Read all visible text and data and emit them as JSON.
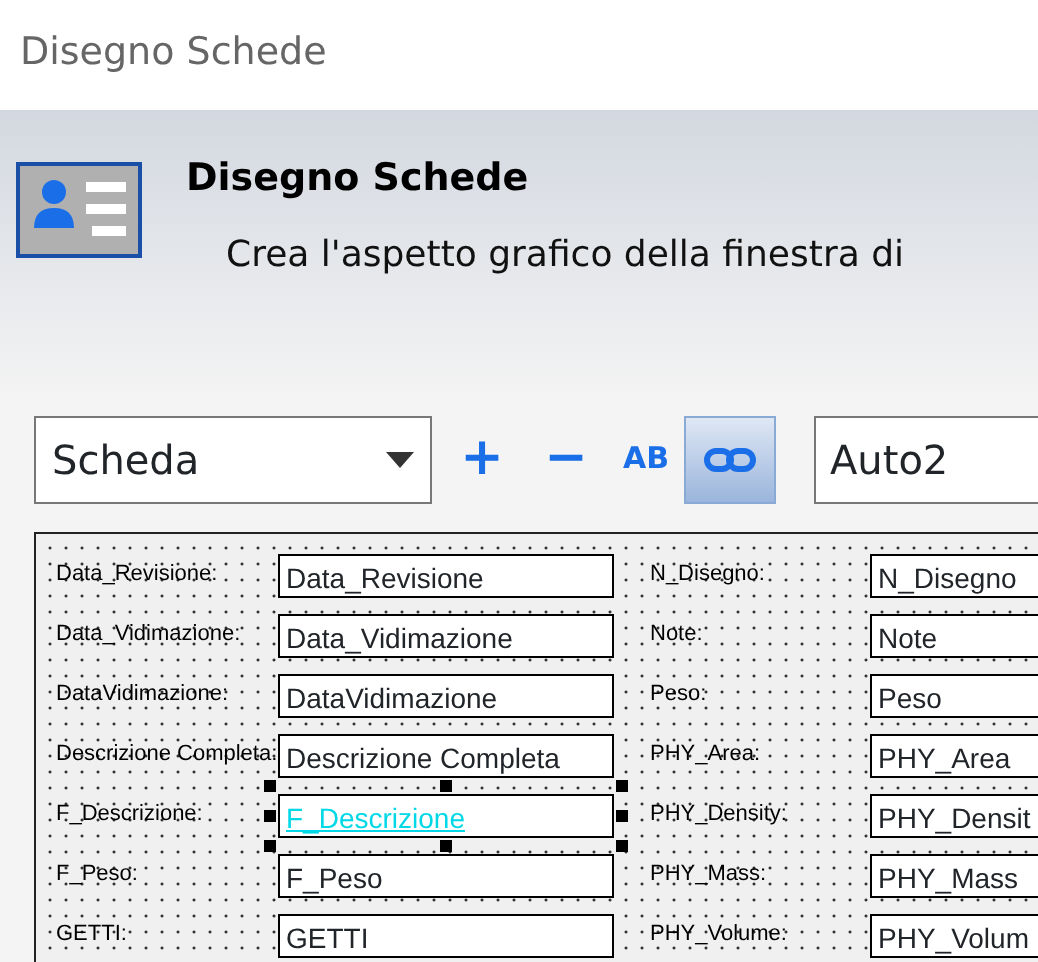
{
  "window": {
    "title": "Disegno Schede"
  },
  "header": {
    "title": "Disegno Schede",
    "subtitle": "Crea l'aspetto grafico della finestra di"
  },
  "toolbar": {
    "selector": {
      "value": "Scheda"
    },
    "tools": [
      {
        "kind": "add",
        "label": "+",
        "pressed": false
      },
      {
        "kind": "remove",
        "label": "−",
        "pressed": false
      },
      {
        "kind": "text",
        "label": "AB",
        "pressed": false
      },
      {
        "kind": "link",
        "pressed": true
      }
    ],
    "name_field": {
      "value": "Auto2"
    }
  },
  "canvas": {
    "rows": [
      [
        {
          "label": "Data_Revisione:",
          "value": "Data_Revisione",
          "selected": false
        },
        {
          "label": "N_Disegno:",
          "value": "N_Disegno",
          "selected": false
        }
      ],
      [
        {
          "label": "Data_Vidimazione:",
          "value": "Data_Vidimazione",
          "selected": false
        },
        {
          "label": "Note:",
          "value": "Note",
          "selected": false
        }
      ],
      [
        {
          "label": "DataVidimazione:",
          "value": "DataVidimazione",
          "selected": false
        },
        {
          "label": "Peso:",
          "value": "Peso",
          "selected": false
        }
      ],
      [
        {
          "label": "Descrizione Completa:",
          "value": "Descrizione Completa",
          "selected": false
        },
        {
          "label": "PHY_Area:",
          "value": "PHY_Area",
          "selected": false
        }
      ],
      [
        {
          "label": "F_Descrizione:",
          "value": "F_Descrizione",
          "selected": true
        },
        {
          "label": "PHY_Density:",
          "value": "PHY_Densit",
          "selected": false
        }
      ],
      [
        {
          "label": "F_Peso:",
          "value": "F_Peso",
          "selected": false
        },
        {
          "label": "PHY_Mass:",
          "value": "PHY_Mass",
          "selected": false
        }
      ],
      [
        {
          "label": "GETTI:",
          "value": "GETTI",
          "selected": false
        },
        {
          "label": "PHY_Volume:",
          "value": "PHY_Volum",
          "selected": false
        }
      ]
    ]
  }
}
